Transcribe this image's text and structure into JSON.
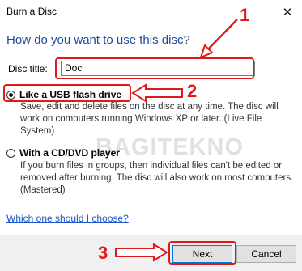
{
  "window": {
    "title": "Burn a Disc",
    "close_glyph": "✕"
  },
  "heading": "How do you want to use this disc?",
  "disc_title": {
    "label": "Disc title:",
    "value": "Doc"
  },
  "options": [
    {
      "label": "Like a USB flash drive",
      "selected": true,
      "description": "Save, edit and delete files on the disc at any time. The disc will work on computers running Windows XP or later. (Live File System)"
    },
    {
      "label": "With a CD/DVD player",
      "selected": false,
      "description": "If you burn files in groups, then individual files can't be edited or removed after burning. The disc will also work on most computers. (Mastered)"
    }
  ],
  "help_link": "Which one should I choose?",
  "buttons": {
    "next": "Next",
    "cancel": "Cancel"
  },
  "watermark": "BAGITEKNO",
  "annotations": {
    "step1": "1",
    "step2": "2",
    "step3": "3",
    "color": "#e01a1a"
  }
}
